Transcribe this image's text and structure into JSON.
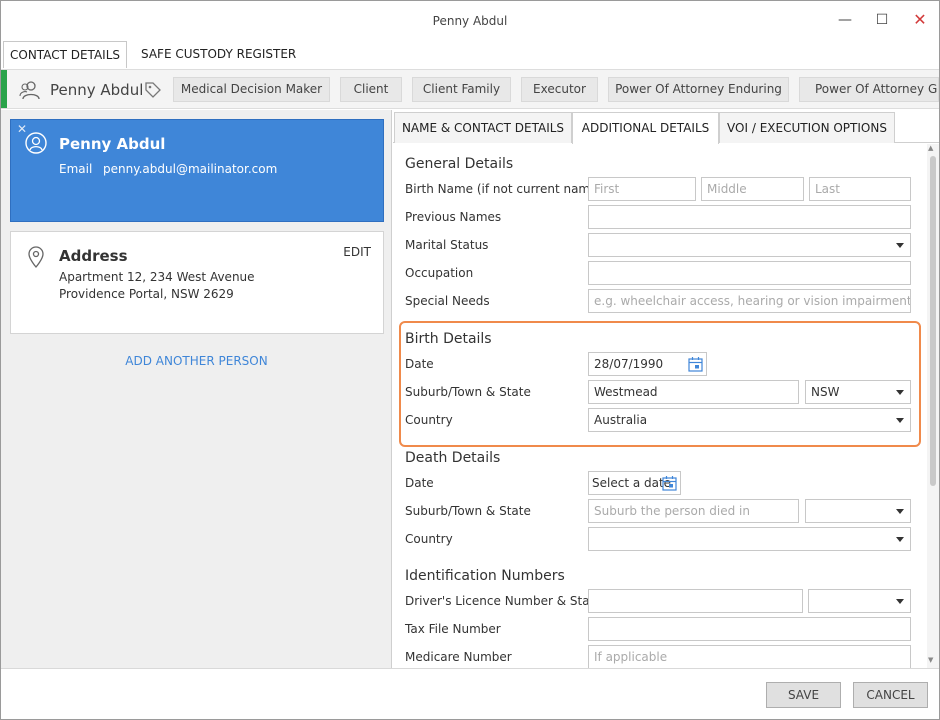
{
  "window": {
    "title": "Penny Abdul",
    "minimize_glyph": "—",
    "maximize_glyph": "☐",
    "close_glyph": "✕"
  },
  "top_tabs": [
    {
      "label": "CONTACT DETAILS",
      "active": true
    },
    {
      "label": "SAFE CUSTODY REGISTER",
      "active": false
    }
  ],
  "person_bar": {
    "name": "Penny Abdul",
    "person_icon": "people-icon",
    "tag_icon": "tag-icon",
    "roles": [
      "Medical Decision Maker",
      "Client",
      "Client Family",
      "Executor",
      "Power Of Attorney Enduring",
      "Power Of Attorney General"
    ]
  },
  "person_card": {
    "close_glyph": "✕",
    "icon": "user-circle-icon",
    "name": "Penny Abdul",
    "email_label": "Email",
    "email": "penny.abdul@mailinator.com"
  },
  "address_card": {
    "icon": "map-pin-icon",
    "title": "Address",
    "edit_label": "EDIT",
    "line1": "Apartment 12, 234 West Avenue",
    "line2": "Providence Portal, NSW 2629"
  },
  "add_person_label": "ADD ANOTHER PERSON",
  "inner_tabs": [
    {
      "label": "NAME & CONTACT DETAILS",
      "active": false
    },
    {
      "label": "ADDITIONAL DETAILS",
      "active": true
    },
    {
      "label": "VOI / EXECUTION OPTIONS",
      "active": false
    }
  ],
  "general": {
    "title": "General Details",
    "birth_name_label": "Birth Name (if not current name)",
    "first_placeholder": "First",
    "middle_placeholder": "Middle",
    "last_placeholder": "Last",
    "previous_names_label": "Previous Names",
    "marital_status_label": "Marital Status",
    "occupation_label": "Occupation",
    "special_needs_label": "Special Needs",
    "special_needs_placeholder": "e.g. wheelchair access, hearing or vision impairment"
  },
  "birth": {
    "title": "Birth Details",
    "date_label": "Date",
    "date_value": "28/07/1990",
    "suburb_label": "Suburb/Town & State",
    "suburb_value": "Westmead",
    "state_value": "NSW",
    "country_label": "Country",
    "country_value": "Australia"
  },
  "death": {
    "title": "Death Details",
    "date_label": "Date",
    "date_placeholder": "Select a date",
    "suburb_label": "Suburb/Town & State",
    "suburb_placeholder": "Suburb the person died in",
    "country_label": "Country"
  },
  "identification": {
    "title": "Identification Numbers",
    "licence_label": "Driver's Licence Number & State",
    "tfn_label": "Tax File Number",
    "medicare_label": "Medicare Number",
    "medicare_placeholder": "If applicable"
  },
  "footer": {
    "save_label": "SAVE",
    "cancel_label": "CANCEL"
  },
  "colors": {
    "accent_blue": "#3f86d8",
    "status_green": "#2aa34a",
    "highlight_orange": "#f08a4b"
  }
}
